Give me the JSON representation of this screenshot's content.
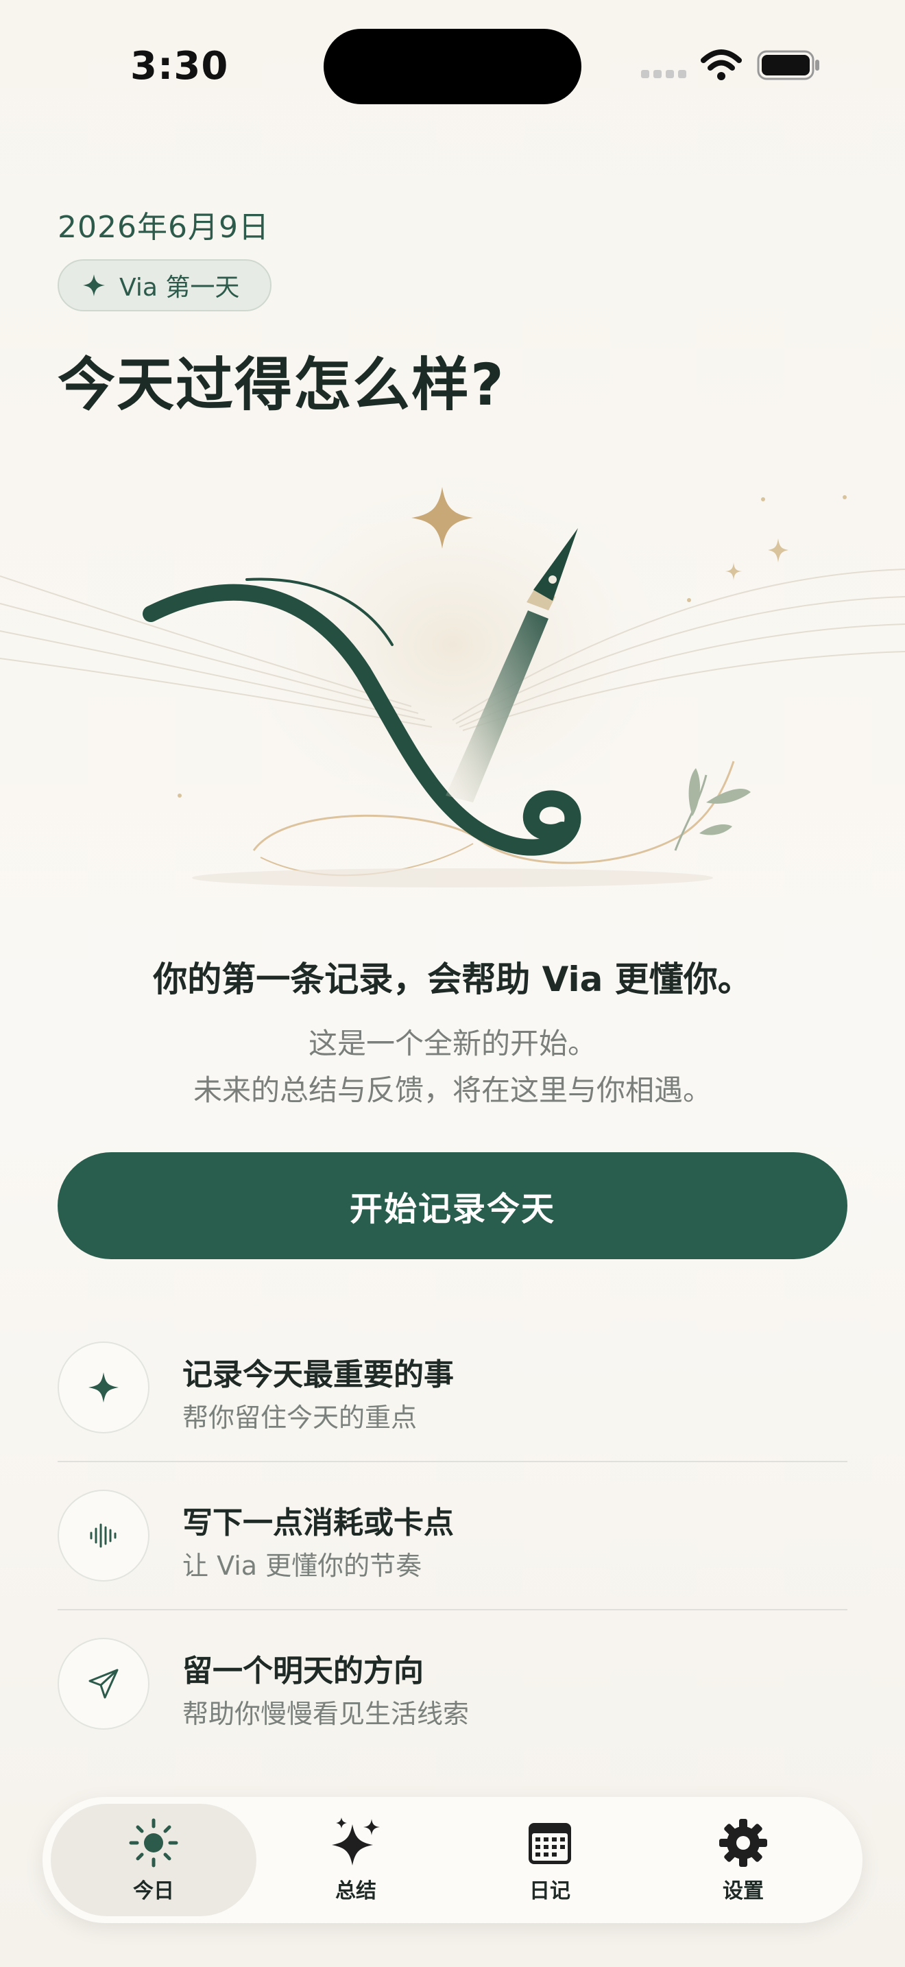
{
  "status_bar": {
    "time": "3:30"
  },
  "header": {
    "date": "2026年6月9日",
    "badge": "Via 第一天",
    "title": "今天过得怎么样?"
  },
  "message": {
    "title": "你的第一条记录，会帮助 Via 更懂你。",
    "line1": "这是一个全新的开始。",
    "line2": "未来的总结与反馈，将在这里与你相遇。"
  },
  "cta": {
    "label": "开始记录今天"
  },
  "prompts": [
    {
      "icon": "sparkle-icon",
      "title": "记录今天最重要的事",
      "subtitle": "帮你留住今天的重点"
    },
    {
      "icon": "waveform-icon",
      "title": "写下一点消耗或卡点",
      "subtitle": "让 Via 更懂你的节奏"
    },
    {
      "icon": "paper-plane-icon",
      "title": "留一个明天的方向",
      "subtitle": "帮助你慢慢看见生活线索"
    }
  ],
  "tabs": [
    {
      "label": "今日",
      "icon": "sun-icon",
      "active": true
    },
    {
      "label": "总结",
      "icon": "sparkles-icon",
      "active": false
    },
    {
      "label": "日记",
      "icon": "calendar-icon",
      "active": false
    },
    {
      "label": "设置",
      "icon": "gear-icon",
      "active": false
    }
  ],
  "colors": {
    "accent": "#295e4e",
    "background": "#f8f5ef",
    "gold": "#c9a877"
  }
}
